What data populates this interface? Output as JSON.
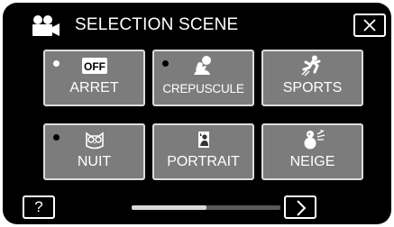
{
  "header": {
    "title": "SELECTION SCENE",
    "mode_icon": "video-camera-icon",
    "close_icon": "close-icon"
  },
  "scenes": [
    {
      "label": "ARRET",
      "icon": "off-icon",
      "icon_text": "OFF",
      "selected": true
    },
    {
      "label": "CREPUSCULE",
      "icon": "twilight-icon",
      "selected": false
    },
    {
      "label": "SPORTS",
      "icon": "sports-icon",
      "selected": false
    },
    {
      "label": "NUIT",
      "icon": "night-owl-icon",
      "selected": false
    },
    {
      "label": "PORTRAIT",
      "icon": "portrait-icon",
      "selected": false
    },
    {
      "label": "NEIGE",
      "icon": "snow-icon",
      "selected": false
    }
  ],
  "footer": {
    "help_label": "?",
    "next_icon": "chevron-right-icon",
    "scroll_position": 0.5
  },
  "colors": {
    "background": "#000000",
    "tile": "#7c7c7c",
    "tile_border": "#dcdcdc",
    "text": "#ffffff"
  }
}
